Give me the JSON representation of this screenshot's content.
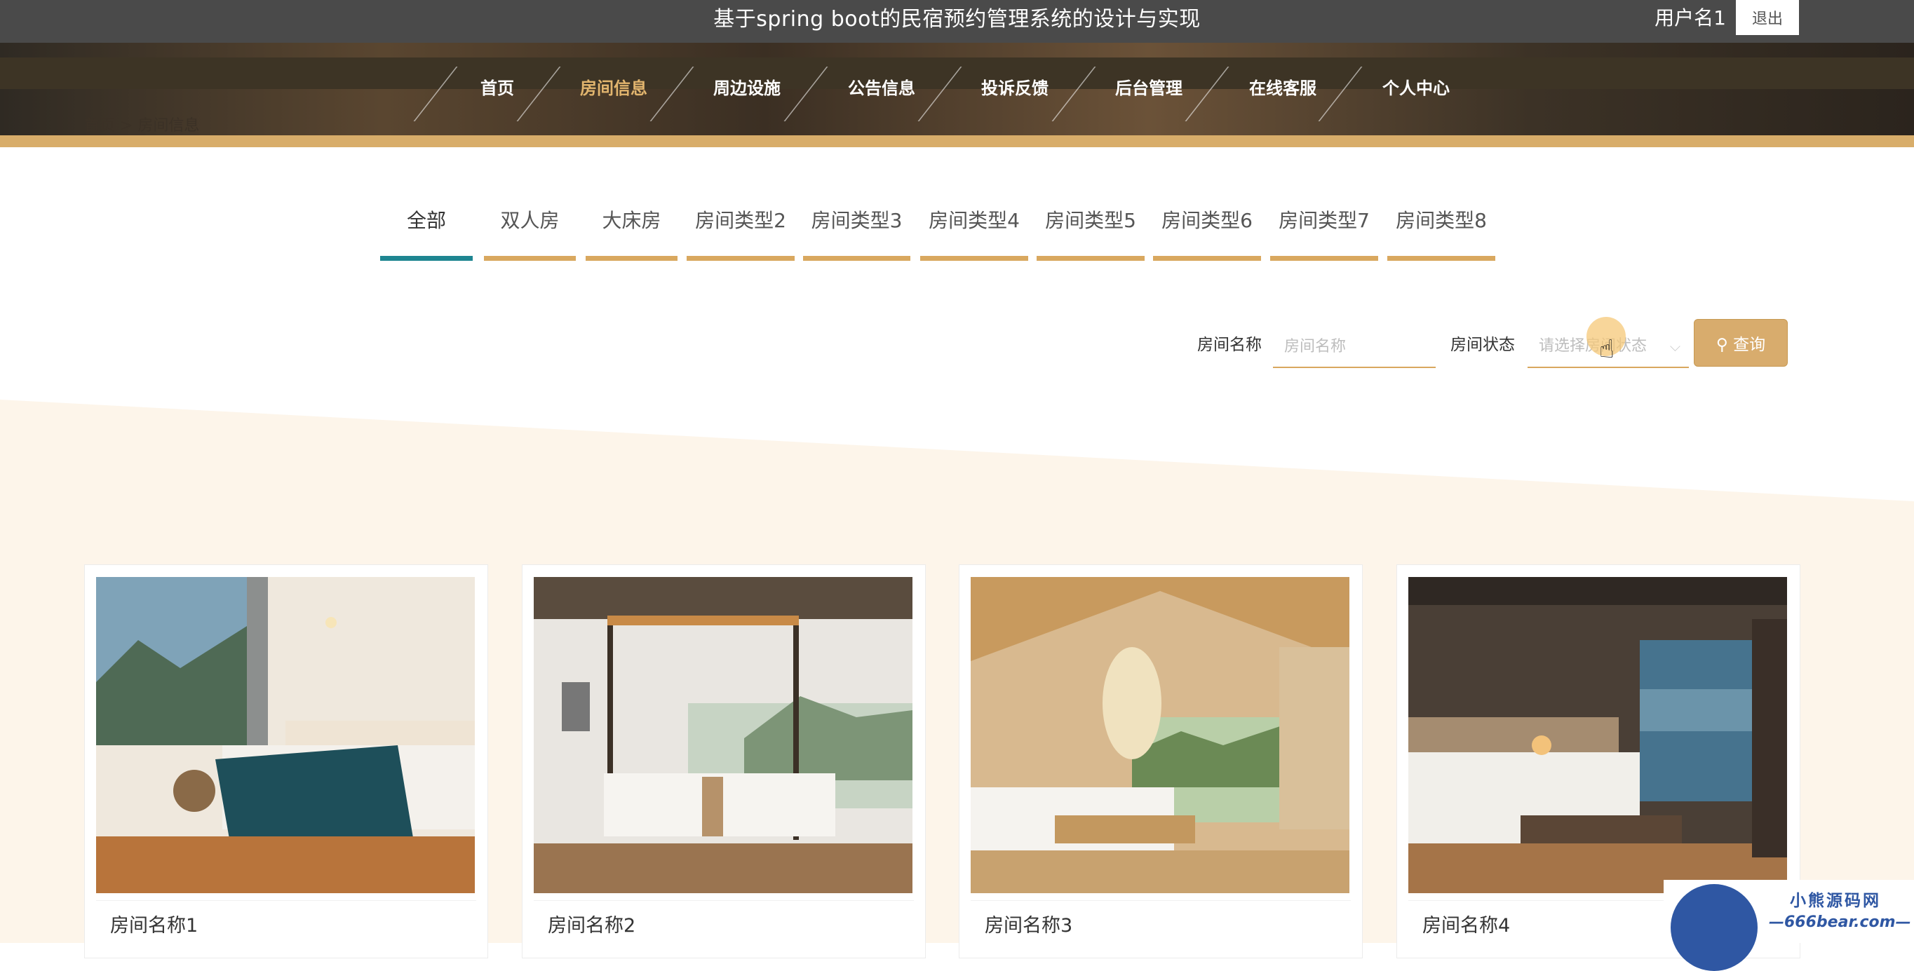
{
  "header": {
    "title": "基于spring boot的民宿预约管理系统的设计与实现",
    "username": "用户名1",
    "logout_label": "退出"
  },
  "breadcrumb": "首页 > 房间信息",
  "nav": [
    "首页",
    "房间信息",
    "周边设施",
    "公告信息",
    "投诉反馈",
    "后台管理",
    "在线客服",
    "个人中心"
  ],
  "tabs": [
    "全部",
    "双人房",
    "大床房",
    "房间类型2",
    "房间类型3",
    "房间类型4",
    "房间类型5",
    "房间类型6",
    "房间类型7",
    "房间类型8"
  ],
  "search": {
    "name_label": "房间名称",
    "name_placeholder": "房间名称",
    "status_label": "房间状态",
    "status_placeholder": "请选择房间状态",
    "button_label": "查询"
  },
  "rooms": [
    {
      "name": "房间名称1"
    },
    {
      "name": "房间名称2"
    },
    {
      "name": "房间名称3"
    },
    {
      "name": "房间名称4"
    }
  ],
  "watermark": {
    "line1": "小熊源码网",
    "line2": "—666bear.com—"
  },
  "colors": {
    "gold": "#d8ac6d",
    "teal": "#1e8591",
    "topbar": "#4a4a4a",
    "beige": "#fdf5ea"
  }
}
